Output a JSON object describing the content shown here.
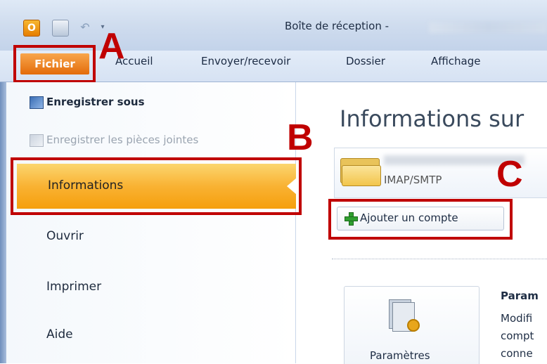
{
  "window": {
    "title": "Boîte de réception -"
  },
  "ribbon": {
    "tabs": [
      "Fichier",
      "Accueil",
      "Envoyer/recevoir",
      "Dossier",
      "Affichage"
    ]
  },
  "file_menu": {
    "save_as": "Enregistrer sous",
    "save_attachments": "Enregistrer les pièces jointes",
    "info": "Informations",
    "open": "Ouvrir",
    "print": "Imprimer",
    "help": "Aide"
  },
  "main": {
    "title": "Informations sur",
    "account_type": "IMAP/SMTP",
    "add_account": "Ajouter un compte",
    "settings_button": "Paramètres",
    "settings_heading": "Param",
    "settings_desc_1": "Modifi",
    "settings_desc_2": "compt",
    "settings_desc_3": "conne"
  },
  "markers": {
    "a": "A",
    "b": "B",
    "c": "C"
  },
  "colors": {
    "highlight": "#c00000",
    "file_tab": "#e36b0a",
    "selected": "#f9b233"
  },
  "icons": [
    "outlook-icon",
    "save-icon",
    "undo-icon",
    "save-as-icon",
    "attachment-icon",
    "folder-icon",
    "plus-icon",
    "settings-icon"
  ]
}
